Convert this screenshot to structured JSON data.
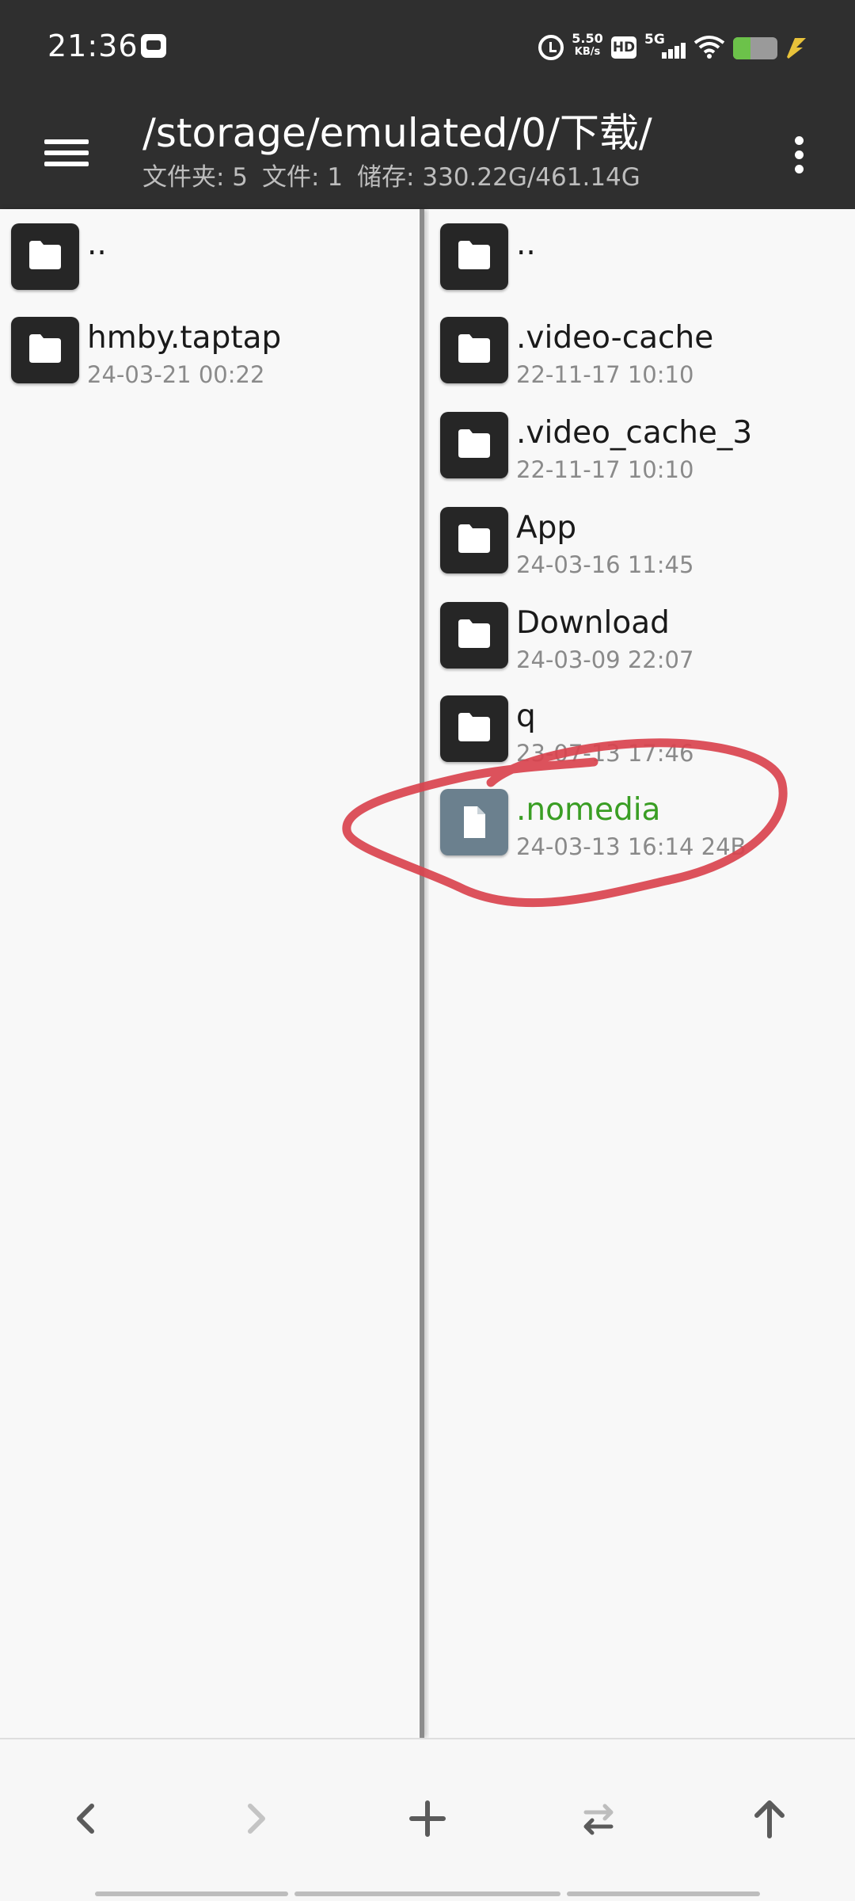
{
  "status_bar": {
    "time": "21:36",
    "net_speed_value": "5.50",
    "net_speed_unit": "KB/s",
    "hd_label": "HD",
    "network_label": "5G",
    "battery_level": 0.4
  },
  "toolbar": {
    "path": "/storage/emulated/0/下载/",
    "stats": {
      "folders": "文件夹: 5",
      "files": "文件: 1",
      "storage": "储存: 330.22G/461.14G"
    }
  },
  "left_pane": {
    "items": [
      {
        "name": "..",
        "meta": "",
        "type": "folder"
      },
      {
        "name": "hmby.taptap",
        "meta": "24-03-21 00:22",
        "type": "folder"
      }
    ]
  },
  "right_pane": {
    "items": [
      {
        "name": "..",
        "meta": "",
        "type": "folder"
      },
      {
        "name": ".video-cache",
        "meta": "22-11-17 10:10",
        "type": "folder"
      },
      {
        "name": ".video_cache_3",
        "meta": "22-11-17 10:10",
        "type": "folder"
      },
      {
        "name": "App",
        "meta": "24-03-16 11:45",
        "type": "folder"
      },
      {
        "name": "Download",
        "meta": "24-03-09 22:07",
        "type": "folder"
      },
      {
        "name": "q",
        "meta": "23-07-13 17:46",
        "type": "folder"
      },
      {
        "name": ".nomedia",
        "meta": "24-03-13 16:14  24B",
        "type": "file"
      }
    ]
  },
  "bottom_bar": {
    "buttons": [
      "back-arrow-icon",
      "forward-arrow-icon",
      "plus-icon",
      "swap-arrows-icon",
      "up-arrow-icon"
    ]
  },
  "colors": {
    "toolbar": "#2f2f2f",
    "folder_icon": "#262626",
    "file_icon": "#6b808e",
    "highlight_file_name": "#3a9e24",
    "annotation": "#d9434e"
  }
}
